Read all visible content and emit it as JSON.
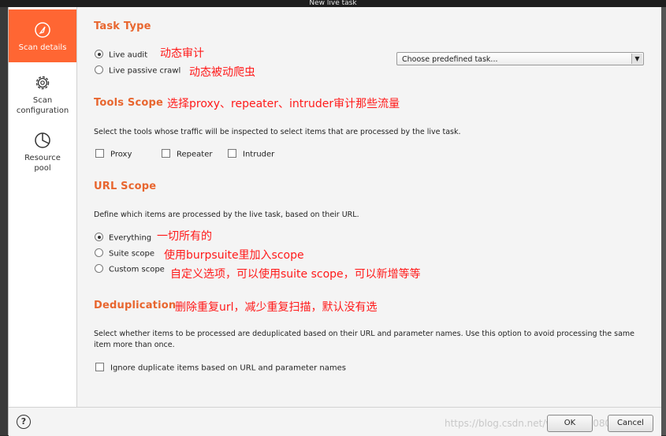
{
  "window": {
    "title": "New live task"
  },
  "sidebar": {
    "items": [
      {
        "label": "Scan details",
        "icon": "scan-details-icon",
        "active": true
      },
      {
        "label": "Scan configuration",
        "icon": "gear-icon",
        "active": false
      },
      {
        "label": "Resource pool",
        "icon": "pie-chart-icon",
        "active": false
      }
    ]
  },
  "task_type": {
    "title": "Task Type",
    "options": [
      {
        "label": "Live audit",
        "selected": true,
        "note": "动态审计"
      },
      {
        "label": "Live passive crawl",
        "selected": false,
        "note": "动态被动爬虫"
      }
    ],
    "predefined_select": "Choose predefined task..."
  },
  "tools_scope": {
    "title": "Tools Scope",
    "note": "选择proxy、repeater、intruder审计那些流量",
    "description": "Select the tools whose traffic will be inspected to select items that are processed by the live task.",
    "tools": [
      {
        "label": "Proxy",
        "checked": false
      },
      {
        "label": "Repeater",
        "checked": false
      },
      {
        "label": "Intruder",
        "checked": false
      }
    ]
  },
  "url_scope": {
    "title": "URL Scope",
    "description": "Define which items are processed by the live task, based on their URL.",
    "options": [
      {
        "label": "Everything",
        "selected": true,
        "note": "一切所有的"
      },
      {
        "label": "Suite scope",
        "selected": false,
        "note": "使用burpsuite里加入scope"
      },
      {
        "label": "Custom scope",
        "selected": false,
        "note": "自定义选项，可以使用suite scope，可以新增等等"
      }
    ]
  },
  "deduplication": {
    "title": "Deduplication",
    "note": "删除重复url，减少重复扫描，默认没有选",
    "description": "Select whether items to be processed are deduplicated based on their URL and parameter names. Use this option to avoid processing the same item more than once.",
    "checkbox_label": "Ignore duplicate items based on URL and parameter names",
    "checked": false
  },
  "footer": {
    "help": "?",
    "watermark": "https://blog.csdn.net/weixin_45080967",
    "ok": "OK",
    "cancel": "Cancel"
  },
  "colors": {
    "accent": "#ff6633",
    "section_title": "#e8662f",
    "annotation": "#ff1a1a"
  }
}
